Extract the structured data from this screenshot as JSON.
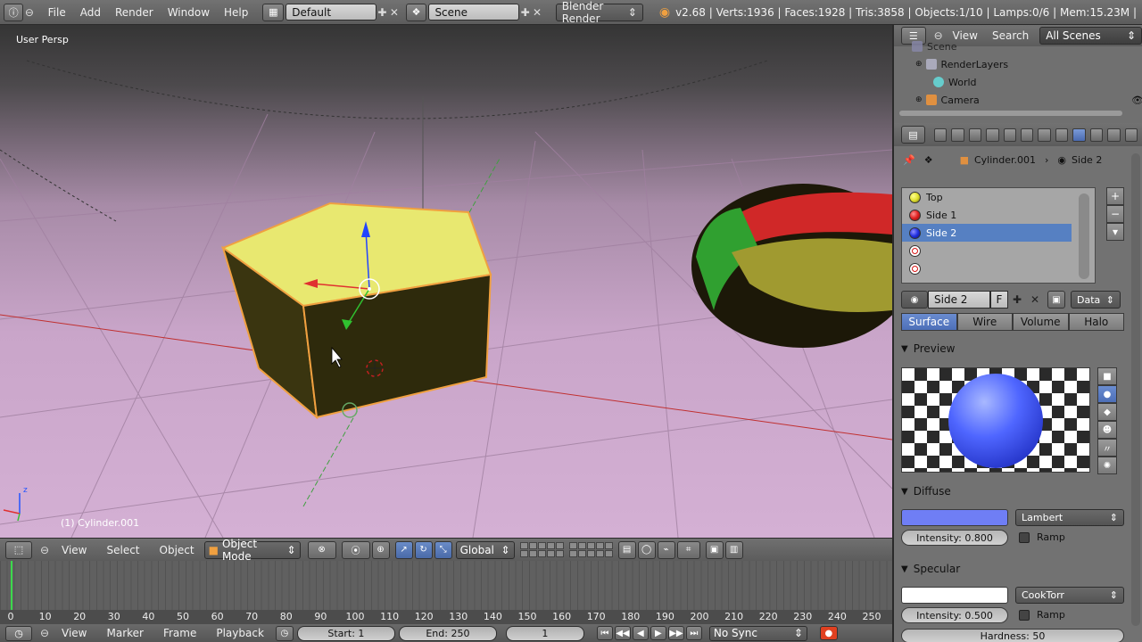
{
  "topbar": {
    "menus": [
      "File",
      "Add",
      "Render",
      "Window",
      "Help"
    ],
    "screen_layout": "Default",
    "scene": "Scene",
    "render_engine": "Blender Render",
    "stats": "v2.68 | Verts:1936 | Faces:1928 | Tris:3858 | Objects:1/10 | Lamps:0/6 | Mem:15.23M |"
  },
  "viewport": {
    "view_label": "User Persp",
    "object_label": "(1) Cylinder.001"
  },
  "view3d_header": {
    "menus": [
      "View",
      "Select",
      "Object"
    ],
    "mode": "Object Mode",
    "orientation": "Global"
  },
  "timeline": {
    "ruler": [
      "0",
      "10",
      "20",
      "30",
      "40",
      "50",
      "60",
      "70",
      "80",
      "90",
      "100",
      "110",
      "120",
      "130",
      "140",
      "150",
      "160",
      "170",
      "180",
      "190",
      "200",
      "210",
      "220",
      "230",
      "240",
      "250"
    ],
    "menus": [
      "View",
      "Marker",
      "Frame",
      "Playback"
    ],
    "start": "Start: 1",
    "end": "End: 250",
    "current": "1",
    "sync": "No Sync"
  },
  "outliner": {
    "menus": [
      "View",
      "Search"
    ],
    "filter": "All Scenes",
    "rows": [
      "Scene",
      "RenderLayers",
      "World",
      "Camera"
    ]
  },
  "properties": {
    "breadcrumb": {
      "object": "Cylinder.001",
      "material": "Side 2"
    },
    "slots": [
      {
        "name": "Top",
        "color": "#e0e030"
      },
      {
        "name": "Side 1",
        "color": "#e02020"
      },
      {
        "name": "Side 2",
        "color": "#2030e0"
      },
      {
        "name": "",
        "color": ""
      },
      {
        "name": "",
        "color": ""
      }
    ],
    "material_name": "Side 2",
    "fake_user": "F",
    "link": "Data",
    "tabs": [
      "Surface",
      "Wire",
      "Volume",
      "Halo"
    ],
    "preview_title": "Preview",
    "diffuse": {
      "title": "Diffuse",
      "color": "#6f7ef5",
      "shader": "Lambert",
      "intensity": "Intensity: 0.800",
      "ramp": "Ramp"
    },
    "specular": {
      "title": "Specular",
      "color": "#ffffff",
      "shader": "CookTorr",
      "intensity": "Intensity: 0.500",
      "ramp": "Ramp",
      "hardness": "Hardness: 50"
    }
  }
}
